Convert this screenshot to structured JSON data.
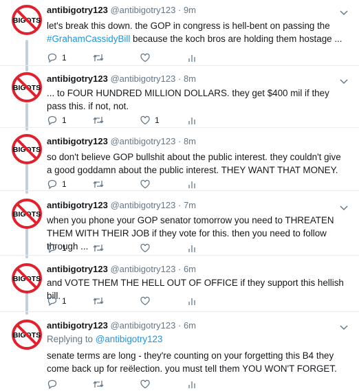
{
  "colors": {
    "accent": "#1b95e0",
    "muted": "#657786",
    "divider": "#e6ecf0",
    "thread": "#c4d0d9",
    "badge": "#e0212e"
  },
  "tweets": [
    {
      "name": "antibigotry123",
      "handle": "@antibigotry123",
      "dot": "·",
      "time": "9m",
      "text_before": "let's break this down. the GOP in congress is hell-bent on passing the ",
      "hashtag": "#GrahamCassidyBill",
      "text_after": " because the koch bros are holding them hostage ...",
      "replies": "1",
      "retweets": "",
      "likes": "",
      "avatar_label": "BIGOTS",
      "icons": [
        "reply-icon",
        "retweet-icon",
        "like-icon",
        "analytics-icon"
      ]
    },
    {
      "name": "antibigotry123",
      "handle": "@antibigotry123",
      "dot": "·",
      "time": "8m",
      "text": "... to FOUR HUNDRED MILLION DOLLARS. they get $400 mil if they pass this. if not, not.",
      "replies": "1",
      "retweets": "",
      "likes": "1",
      "avatar_label": "BIGOTS"
    },
    {
      "name": "antibigotry123",
      "handle": "@antibigotry123",
      "dot": "·",
      "time": "8m",
      "text": "so don't believe GOP bullshit about the public interest. they couldn't give a good goddamn about the public interest. THEY WANT THAT MONEY.",
      "replies": "1",
      "retweets": "",
      "likes": "",
      "avatar_label": "BIGOTS"
    },
    {
      "name": "antibigotry123",
      "handle": "@antibigotry123",
      "dot": "·",
      "time": "7m",
      "text": "when you phone your GOP senator tomorrow you need to THREATEN THEM WITH THEIR JOB if they vote for this. then you need to follow through ...",
      "replies": "1",
      "retweets": "",
      "likes": "",
      "avatar_label": "BIGOTS"
    },
    {
      "name": "antibigotry123",
      "handle": "@antibigotry123",
      "dot": "·",
      "time": "6m",
      "text": "and VOTE THEM THE HELL OUT OF OFFICE if they support this hellish bill.",
      "replies": "1",
      "retweets": "",
      "likes": "",
      "avatar_label": "BIGOTS"
    },
    {
      "name": "antibigotry123",
      "handle": "@antibigotry123",
      "dot": "·",
      "time": "6m",
      "replying_prefix": "Replying to ",
      "replying_handle": "@antibigotry123",
      "text": "senate terms are long - they're counting on your forgetting this B4 they come back up for reëlection. you must tell them YOU WON'T FORGET.",
      "replies": "",
      "retweets": "",
      "likes": "",
      "avatar_label": "BIGOTS"
    }
  ]
}
